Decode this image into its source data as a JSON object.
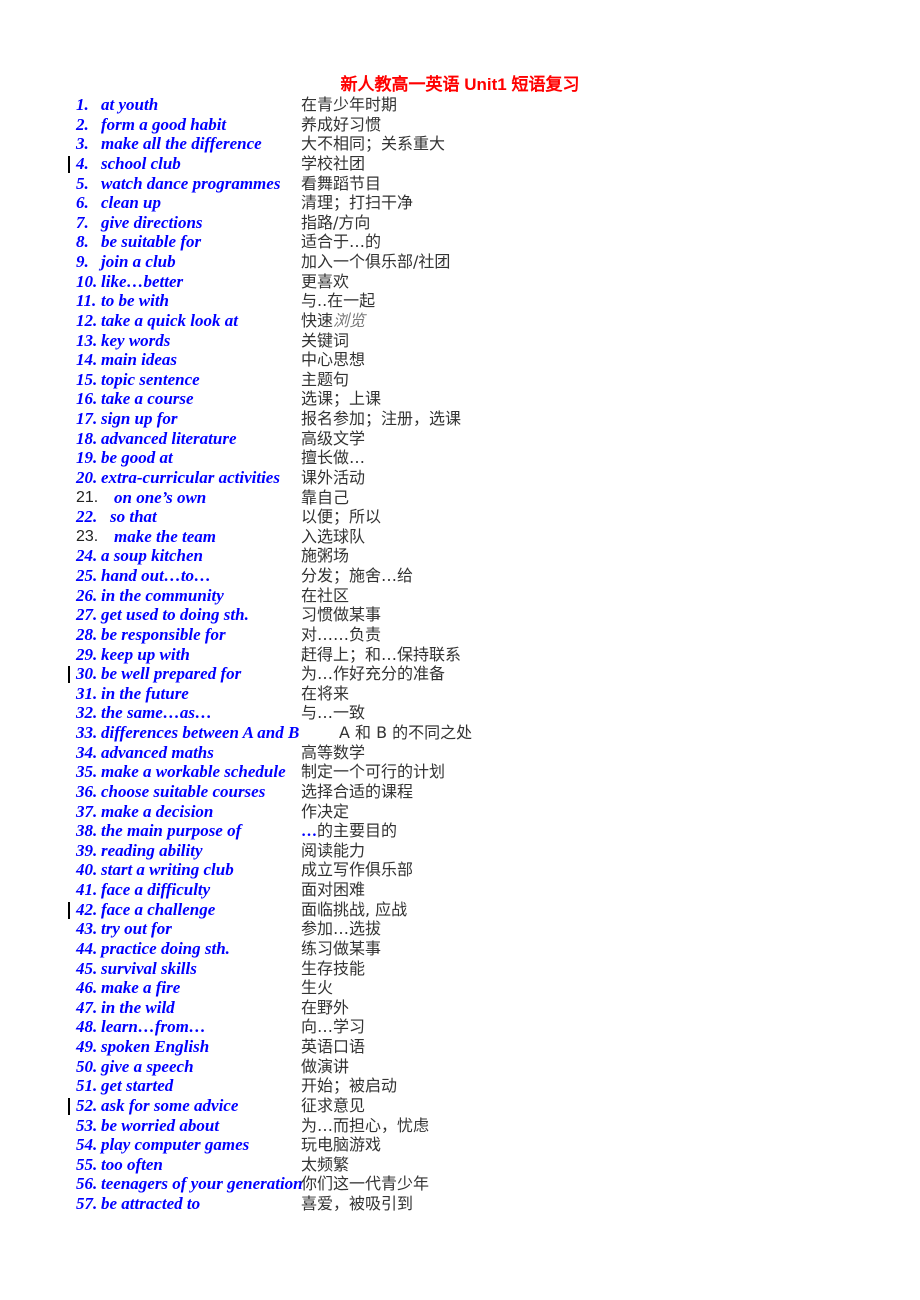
{
  "title": "新人教高一英语 Unit1 短语复习",
  "items": [
    {
      "n": "1.",
      "en": "at youth",
      "zh": "在青少年时期"
    },
    {
      "n": "2.",
      "en": "form a good habit",
      "zh": "养成好习惯"
    },
    {
      "n": "3.",
      "en": "make all the difference",
      "zh": "大不相同；关系重大"
    },
    {
      "n": "4.",
      "en": "school club",
      "zh": "学校社团",
      "bar": true
    },
    {
      "n": "5.",
      "en": "watch dance programmes",
      "zh": "看舞蹈节目"
    },
    {
      "n": "6.",
      "en": "clean up",
      "zh": "清理；打扫干净"
    },
    {
      "n": "7.",
      "en": "give directions",
      "zh": "指路/方向"
    },
    {
      "n": "8.",
      "en": "be suitable for",
      "zh": "适合于…的"
    },
    {
      "n": "9.",
      "en": "join a club",
      "zh": "加入一个俱乐部/社团"
    },
    {
      "n": "10.",
      "en": "like…better",
      "zh": "更喜欢"
    },
    {
      "n": "11.",
      "en": "to be with",
      "zh": "与..在一起"
    },
    {
      "n": "12.",
      "en": "take a quick look at",
      "zh": "快速",
      "zh_italic": "浏览"
    },
    {
      "n": "13.",
      "en": "key words",
      "zh": "关键词"
    },
    {
      "n": "14.",
      "en": "main ideas",
      "zh": "中心思想"
    },
    {
      "n": "15.",
      "en": "topic sentence",
      "zh": "主题句"
    },
    {
      "n": "16.",
      "en": "take a course",
      "zh": "选课；上课"
    },
    {
      "n": "17.",
      "en": "sign up for",
      "zh": "报名参加；注册，选课"
    },
    {
      "n": "18.",
      "en": "advanced literature",
      "zh": "高级文学"
    },
    {
      "n": "19.",
      "en": "be good at",
      "zh": "擅长做…"
    },
    {
      "n": "20.",
      "en": "extra-curricular activities",
      "zh": "课外活动"
    },
    {
      "n": "21.",
      "en": "on one’s own",
      "zh": "靠自己",
      "plain_num": true
    },
    {
      "n": "22.",
      "en": "so that",
      "zh": "以便；所以"
    },
    {
      "n": "23.",
      "en": "make the team",
      "zh": "入选球队",
      "plain_num": true
    },
    {
      "n": "24.",
      "en": "a soup kitchen",
      "zh": "施粥场"
    },
    {
      "n": "25.",
      "en": "hand out…to…",
      "zh": "分发；施舍…给"
    },
    {
      "n": "26.",
      "en": "in the community",
      "zh": "在社区"
    },
    {
      "n": "27.",
      "en": "get used to doing sth.",
      "zh": "习惯做某事"
    },
    {
      "n": "28.",
      "en": "be responsible for",
      "zh": "对……负责"
    },
    {
      "n": "29.",
      "en": "keep up with",
      "zh": "赶得上；和…保持联系"
    },
    {
      "n": "30.",
      "en": "be well prepared for",
      "zh": "为…作好充分的准备",
      "bar": true
    },
    {
      "n": "31.",
      "en": "in the future",
      "zh": "在将来"
    },
    {
      "n": "32.",
      "en": "the same…as…",
      "zh": "与…一致"
    },
    {
      "n": "33.",
      "en": "differences between A and B",
      "zh": "A 和 B 的不同之处",
      "zh_shift": true
    },
    {
      "n": "34.",
      "en": "advanced maths",
      "zh": "高等数学"
    },
    {
      "n": "35.",
      "en": "make a workable schedule",
      "zh": "制定一个可行的计划"
    },
    {
      "n": "36.",
      "en": "choose suitable courses",
      "zh": "选择合适的课程"
    },
    {
      "n": "37.",
      "en": "make a decision",
      "zh": "作决定"
    },
    {
      "n": "38.",
      "en": "the main purpose of",
      "zh_bold": "…",
      "zh": "的主要目的"
    },
    {
      "n": "39.",
      "en": "reading ability",
      "zh": "阅读能力"
    },
    {
      "n": "40.",
      "en": "start a writing club",
      "zh": "成立写作俱乐部"
    },
    {
      "n": "41.",
      "en": "face a difficulty",
      "zh": "面对困难"
    },
    {
      "n": "42.",
      "en": "face a challenge",
      "zh": "面临挑战, 应战",
      "bar": true
    },
    {
      "n": "43.",
      "en": "try out for",
      "zh": "参加…选拔"
    },
    {
      "n": "44.",
      "en": "practice doing sth.",
      "zh": "练习做某事"
    },
    {
      "n": "45.",
      "en": "survival skills",
      "zh": "生存技能"
    },
    {
      "n": "46.",
      "en": "make a fire",
      "zh": "生火"
    },
    {
      "n": "47.",
      "en": "in the wild",
      "zh": "在野外"
    },
    {
      "n": "48.",
      "en": "learn…from…",
      "zh": "向…学习"
    },
    {
      "n": "49.",
      "en": "spoken English",
      "zh": "英语口语"
    },
    {
      "n": "50.",
      "en": "give a speech",
      "zh": "做演讲"
    },
    {
      "n": "51.",
      "en": "get started",
      "zh": "开始；被启动"
    },
    {
      "n": "52.",
      "en": "ask for some advice",
      "zh": "征求意见",
      "bar": true
    },
    {
      "n": "53.",
      "en": "be worried about",
      "zh": "为…而担心，忧虑"
    },
    {
      "n": "54.",
      "en": "play computer games",
      "zh": "玩电脑游戏"
    },
    {
      "n": "55.",
      "en": "too often",
      "zh": "太频繁"
    },
    {
      "n": "56.",
      "en": "teenagers of your generation",
      "zh": "你们这一代青少年"
    },
    {
      "n": "57.",
      "en": "be attracted to",
      "zh": "喜爱，被吸引到"
    }
  ]
}
